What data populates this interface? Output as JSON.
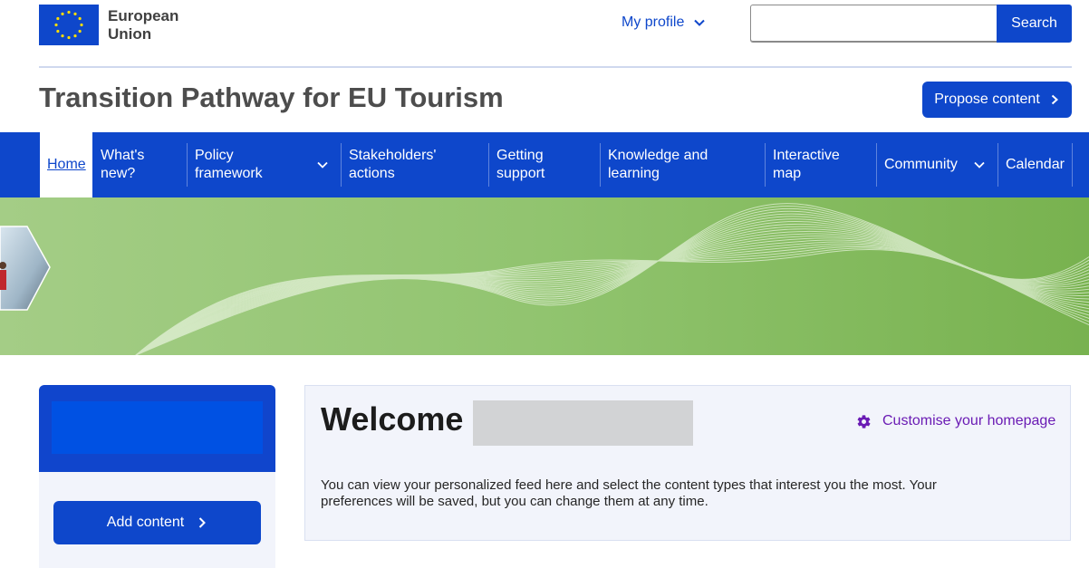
{
  "header": {
    "logo_line1": "European",
    "logo_line2": "Union",
    "profile_label": "My profile",
    "search_placeholder": "",
    "search_button": "Search"
  },
  "site": {
    "title": "Transition Pathway for EU Tourism",
    "propose_label": "Propose content"
  },
  "nav": {
    "items": [
      {
        "label": "Home",
        "active": true
      },
      {
        "label": "What's new?"
      },
      {
        "label": "Policy framework",
        "has_dropdown": true
      },
      {
        "label": "Stakeholders' actions"
      },
      {
        "label": "Getting support"
      },
      {
        "label": "Knowledge and learning"
      },
      {
        "label": "Interactive map"
      },
      {
        "label": "Community",
        "has_dropdown": true
      },
      {
        "label": "Calendar"
      }
    ]
  },
  "sidebar": {
    "add_content_label": "Add content"
  },
  "welcome": {
    "heading": "Welcome",
    "customise_label": "Customise your homepage",
    "description": "You can view your personalized feed here and select the content types that interest you the most. Your preferences will be saved, but you can change them at any time."
  },
  "colors": {
    "primary": "#0e47cb",
    "banner_green": "#8dc06c",
    "customise_purple": "#6a1bb4",
    "panel_bg": "#f2f4fb"
  },
  "icons": [
    "eu-flag-icon",
    "chevron-down-icon",
    "chevron-right-icon",
    "gear-icon"
  ]
}
